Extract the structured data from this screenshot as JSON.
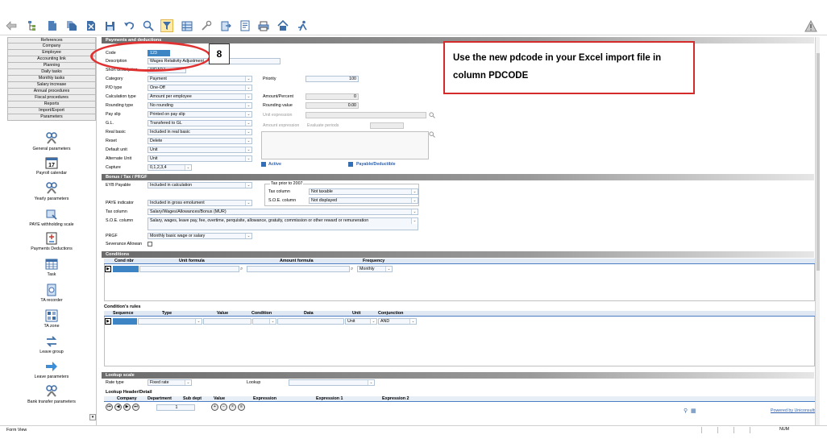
{
  "toolbar": {
    "icons": [
      "back-arrow-icon",
      "tree-icon",
      "document-icon",
      "documents-icon",
      "delete-icon",
      "save-icon",
      "undo-icon",
      "search-icon",
      "filter-icon",
      "table-icon",
      "tools-icon",
      "export-icon",
      "report-icon",
      "print-icon",
      "home-icon",
      "run-icon"
    ],
    "warning_icon": "warning-icon"
  },
  "sidebar": {
    "nav": [
      "References",
      "Company",
      "Employee",
      "Accounting link",
      "Planning",
      "Daily tasks",
      "Monthly tasks",
      "Salary increase",
      "Annual procedures",
      "Fiscal procedures",
      "Reports",
      "Import/Export",
      "Parameters"
    ],
    "items": [
      {
        "label": "General parameters",
        "icon": "tools-icon"
      },
      {
        "label": "Payroll calendar",
        "icon": "calendar-icon",
        "icon_text": "17"
      },
      {
        "label": "Yearly parameters",
        "icon": "tools-icon"
      },
      {
        "label": "PAYE withholding scale",
        "icon": "scale-icon"
      },
      {
        "label": "Payments Deductions",
        "icon": "plus-minus-icon"
      },
      {
        "label": "Task",
        "icon": "grid-icon"
      },
      {
        "label": "TA recorder",
        "icon": "recorder-icon"
      },
      {
        "label": "TA zone",
        "icon": "zone-icon"
      },
      {
        "label": "Leave group",
        "icon": "transfer-icon"
      },
      {
        "label": "Leave parameters",
        "icon": "arrow-icon"
      },
      {
        "label": "Bank transfer parameters",
        "icon": "tools-icon"
      }
    ]
  },
  "form": {
    "title": "Payments and deductions",
    "code_label": "Code",
    "code_value": "123",
    "description_label": "Description",
    "description_value": "Wages Relativity Adjustment",
    "short_description_label": "Short description",
    "short_description_value": "WRADJ",
    "category_label": "Category",
    "category_value": "Payment",
    "pd_type_label": "P/D type",
    "pd_type_value": "One-Off",
    "calculation_type_label": "Calculation type",
    "calculation_type_value": "Amount per employee",
    "rounding_type_label": "Rounding type",
    "rounding_type_value": "No rounding",
    "pay_slip_label": "Pay slip",
    "pay_slip_value": "Printed on pay slip",
    "gl_label": "G.L.",
    "gl_value": "Transfered to GL",
    "real_basic_label": "Real basic",
    "real_basic_value": "Included in real basic",
    "reset_label": "Reset",
    "reset_value": "Delete",
    "default_unit_label": "Default unit",
    "default_unit_value": "Unit",
    "alternate_unit_label": "Alternate Unit",
    "alternate_unit_value": "Unit",
    "capture_label": "Capture",
    "capture_value": "0,1,2,3,4",
    "priority_label": "Priority",
    "priority_value": "100",
    "amount_percent_label": "Amount/Percent",
    "amount_percent_value": "0",
    "rounding_value_label": "Rounding value",
    "rounding_value_value": "0.00",
    "unit_expression_label": "Unit expression",
    "amount_expression_label": "Amount expression",
    "evaluate_periods_label": "Evaluate periods",
    "active_label": "Active",
    "payable_label": "Payable/Deductible"
  },
  "bonus": {
    "title": "Bonus / Tax / PRGF",
    "eyb_payable_label": "EYB Payable",
    "eyb_payable_value": "Included in calculation",
    "tax_prior_label": "Tax prior to 2007",
    "tax_column_label_1": "Tax column",
    "tax_column_value_1": "Not taxable",
    "soe_column_label_1": "S.O.E. column",
    "soe_column_value_1": "Not displayed",
    "paye_indicator_label": "PAYE indicator",
    "paye_indicator_value": "Included in gross emolument",
    "tax_column_label": "Tax column",
    "tax_column_value": "Salary/Wages/Allowances/Bonus (MUR)",
    "soe_column_label": "S.O.E. column",
    "soe_column_value": "Salary, wages, leave pay, fee, overtime, perquisite, allowance, gratuity, commission or other reward or remuneration",
    "prgf_label": "PRGF",
    "prgf_value": "Monthly basic wage or salary",
    "severance_label": "Severance Allowan"
  },
  "conditions": {
    "title": "Conditions",
    "headers": [
      "Cond nbr",
      "Unit formula",
      "Amount formula",
      "Frequency"
    ],
    "row": {
      "frequency": "Monthly"
    }
  },
  "rules": {
    "title": "Condition's rules",
    "headers": [
      "Sequence",
      "Type",
      "Value",
      "Condition",
      "Data",
      "Unit",
      "Conjunction"
    ],
    "row": {
      "unit": "Unit",
      "conjunction": "AND"
    }
  },
  "lookup": {
    "title": "Lookup scale",
    "rate_type_label": "Rate type",
    "rate_type_value": "Fixed rate",
    "lookup_label": "Lookup",
    "detail_title": "Lookup Header/Detail",
    "headers": [
      "Company",
      "Department",
      "Sub dept",
      "Value",
      "Expression",
      "Expression 1",
      "Expression 2"
    ],
    "page_number": "1"
  },
  "footer": {
    "powered_by": "Powered by Uniconsults",
    "form_view": "Form View",
    "num_indicator": "NUM"
  },
  "annotation": {
    "badge": "8",
    "callout_line1": "Use the new pdcode in your Excel import file in",
    "callout_line2": "column PDCODE"
  },
  "colors": {
    "accent": "#3c84c4",
    "annotation_red": "#e03030",
    "field_bg": "#f4f7fb",
    "section_dark": "#6b6b6b"
  }
}
